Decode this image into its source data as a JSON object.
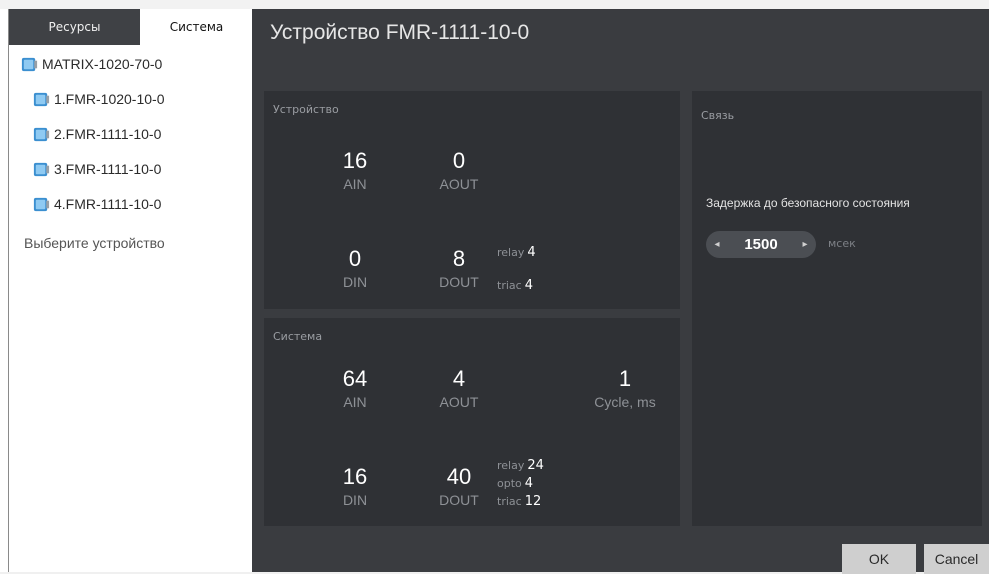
{
  "tabs": {
    "resources": "Ресурсы",
    "system": "Система"
  },
  "tree": {
    "root": "MATRIX-1020-70-0",
    "children": [
      "1.FMR-1020-10-0",
      "2.FMR-1111-10-0",
      "3.FMR-1111-10-0",
      "4.FMR-1111-10-0"
    ],
    "hint": "Выберите устройство"
  },
  "main": {
    "title": "Устройство FMR-1111-10-0",
    "device": {
      "title": "Устройство",
      "ain": {
        "value": "16",
        "label": "AIN"
      },
      "aout": {
        "value": "0",
        "label": "AOUT"
      },
      "din": {
        "value": "0",
        "label": "DIN"
      },
      "dout": {
        "value": "8",
        "label": "DOUT"
      },
      "relay": {
        "label": "relay",
        "value": "4"
      },
      "triac": {
        "label": "triac",
        "value": "4"
      }
    },
    "system": {
      "title": "Система",
      "ain": {
        "value": "64",
        "label": "AIN"
      },
      "aout": {
        "value": "4",
        "label": "AOUT"
      },
      "cycle": {
        "value": "1",
        "label": "Cycle, ms"
      },
      "din": {
        "value": "16",
        "label": "DIN"
      },
      "dout": {
        "value": "40",
        "label": "DOUT"
      },
      "relay": {
        "label": "relay",
        "value": "24"
      },
      "opto": {
        "label": "opto",
        "value": "4"
      },
      "triac": {
        "label": "triac",
        "value": "12"
      }
    },
    "link": {
      "title": "Связь",
      "delay_label": "Задержка до безопасного состояния",
      "delay_value": "1500",
      "unit": "мсек"
    }
  },
  "buttons": {
    "ok": "OK",
    "cancel": "Cancel"
  }
}
